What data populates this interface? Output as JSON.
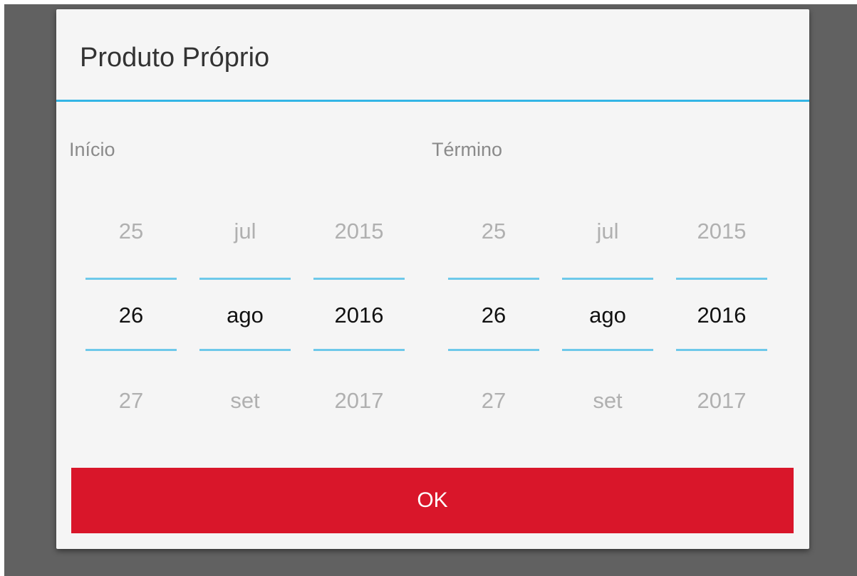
{
  "dialog": {
    "title": "Produto Próprio",
    "accent_color": "#33b5e5",
    "ok_button": {
      "label": "OK",
      "color": "#d9162a"
    }
  },
  "inicio": {
    "label": "Início",
    "day": {
      "prev": "25",
      "selected": "26",
      "next": "27"
    },
    "month": {
      "prev": "jul",
      "selected": "ago",
      "next": "set"
    },
    "year": {
      "prev": "2015",
      "selected": "2016",
      "next": "2017"
    }
  },
  "termino": {
    "label": "Término",
    "day": {
      "prev": "25",
      "selected": "26",
      "next": "27"
    },
    "month": {
      "prev": "jul",
      "selected": "ago",
      "next": "set"
    },
    "year": {
      "prev": "2015",
      "selected": "2016",
      "next": "2017"
    }
  }
}
